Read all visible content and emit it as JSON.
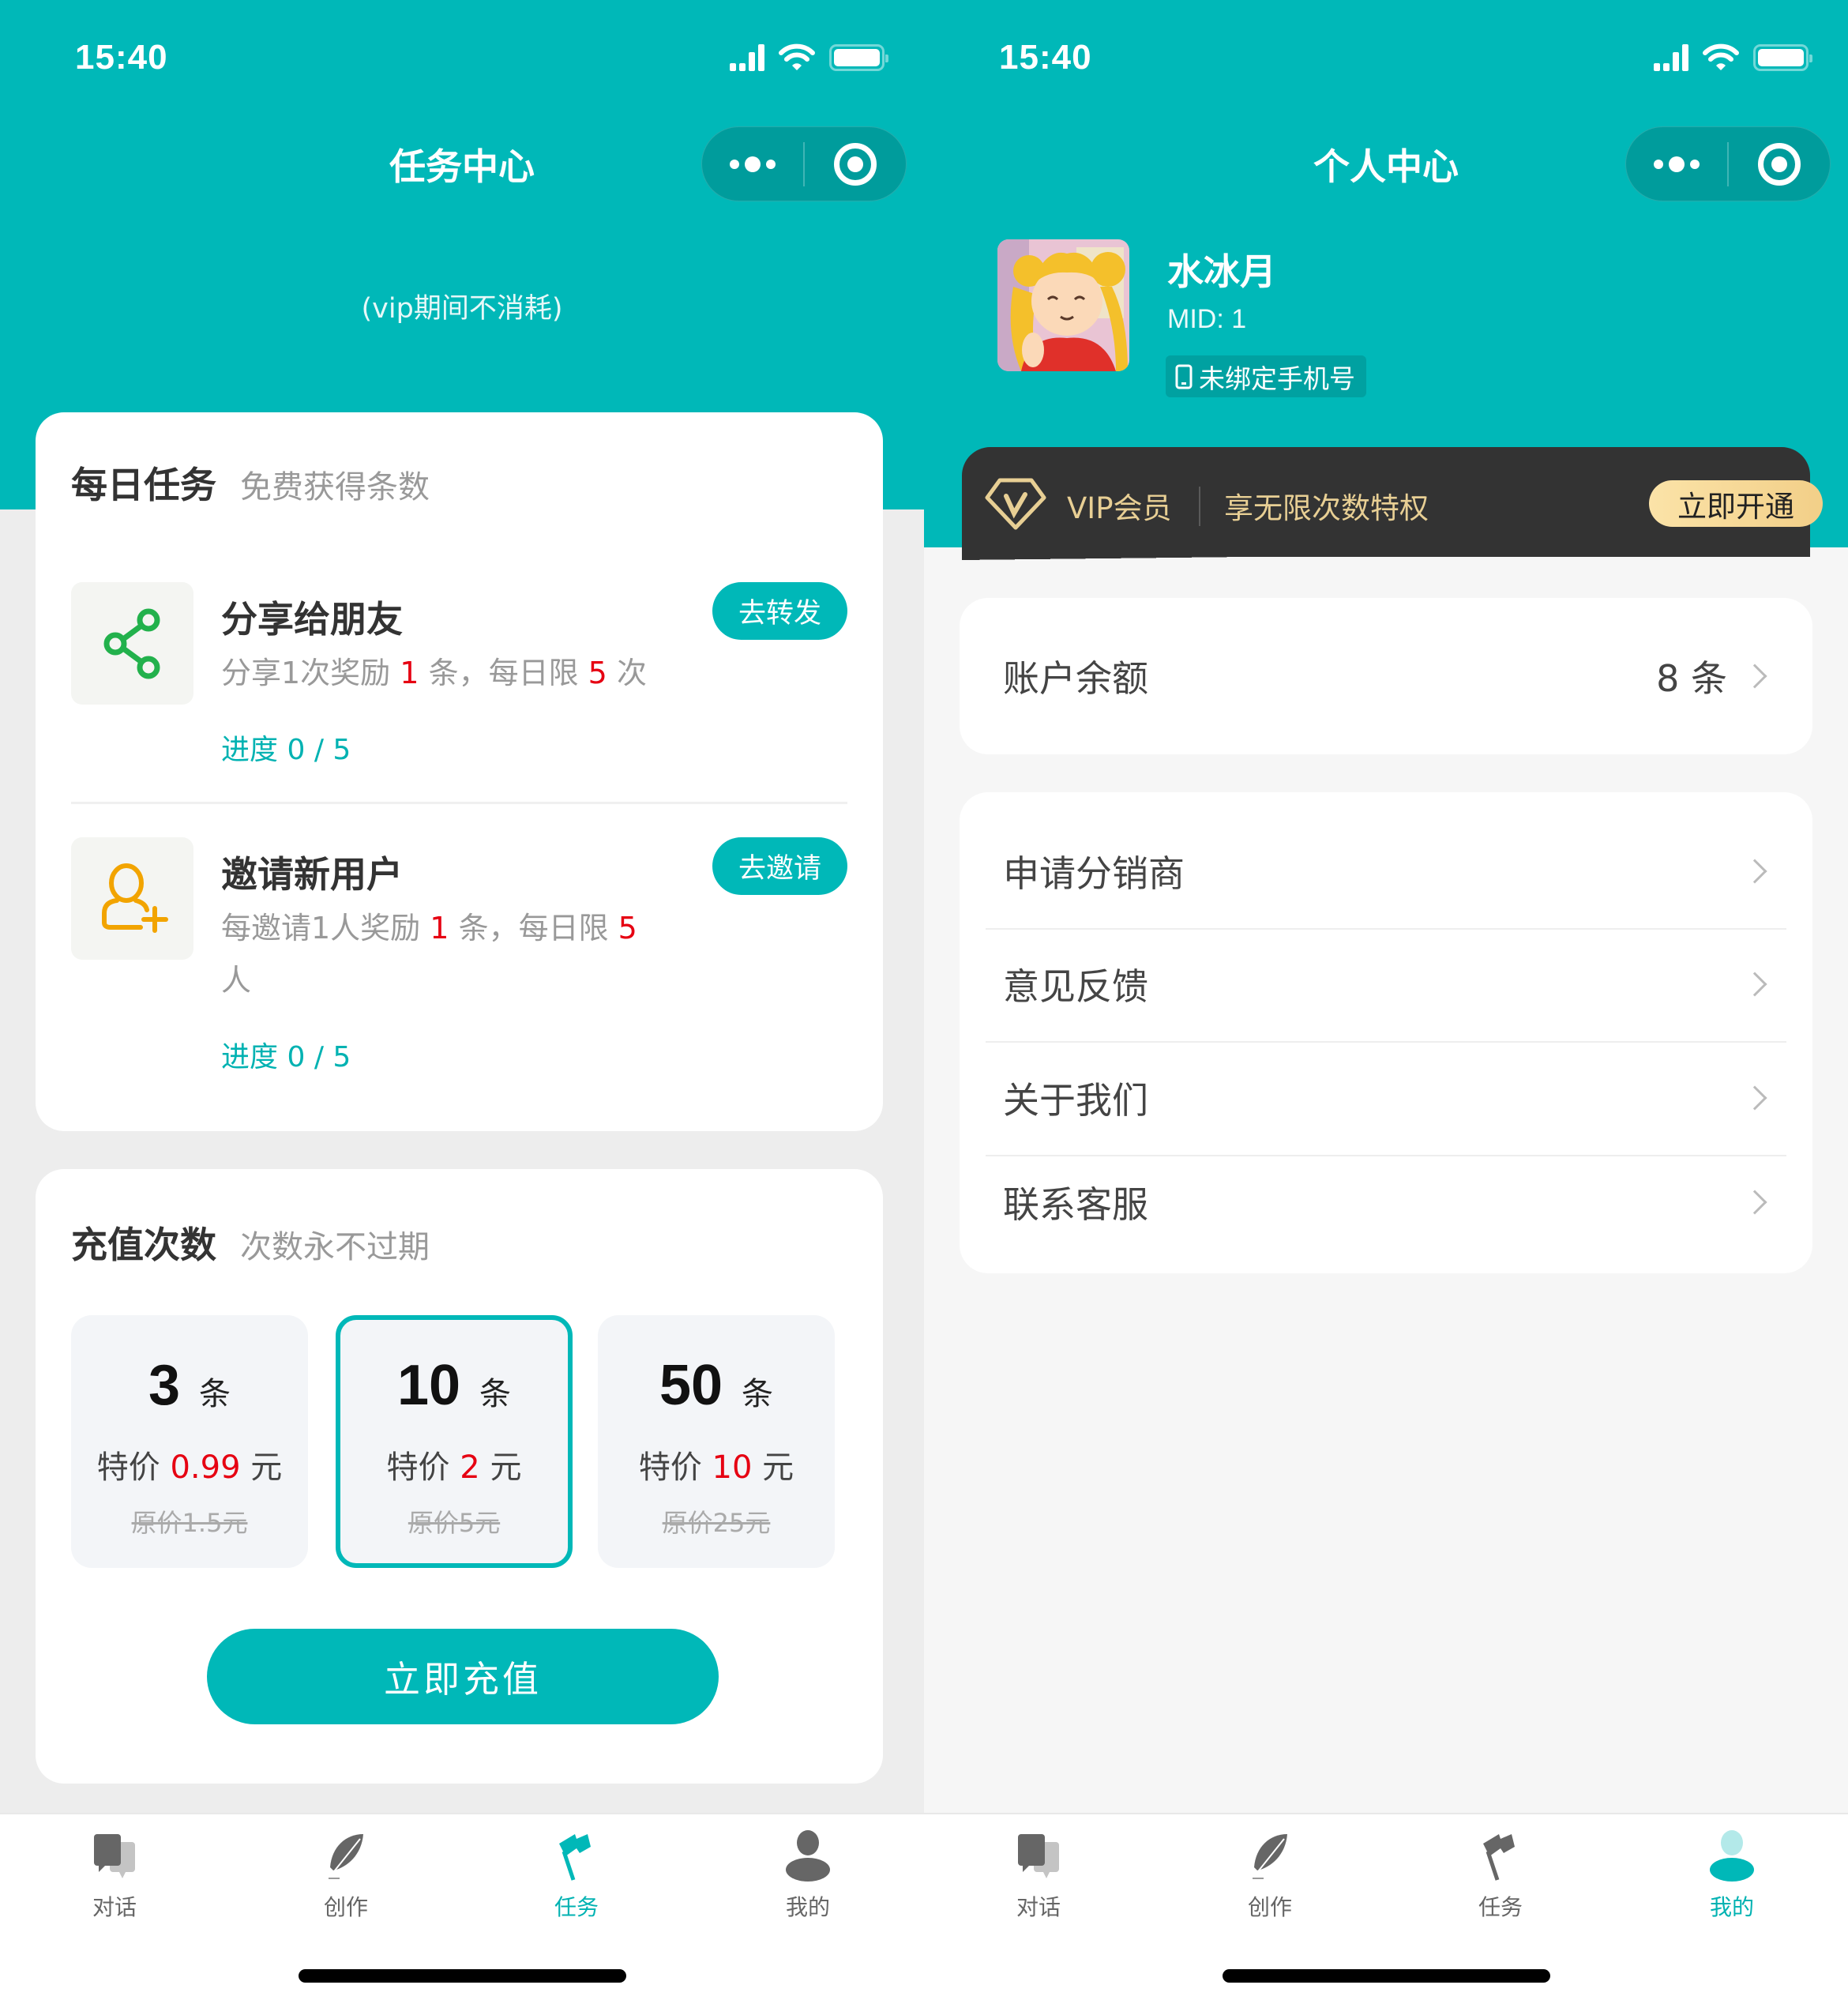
{
  "status_bar": {
    "time": "15:40"
  },
  "task_page": {
    "title": "任务中心",
    "subtitle": "(vip期间不消耗)",
    "daily": {
      "title": "每日任务",
      "subtitle": "免费获得条数",
      "tasks": [
        {
          "icon": "share-icon",
          "icon_color": "#22b14c",
          "title": "分享给朋友",
          "desc_prefix": "分享1次奖励",
          "reward": "1",
          "desc_mid": "条，每日限",
          "limit": "5",
          "desc_suffix": "次",
          "progress_label": "进度",
          "progress": "0 / 5",
          "button": "去转发"
        },
        {
          "icon": "add-user-icon",
          "icon_color": "#f2a400",
          "title": "邀请新用户",
          "desc_prefix": "每邀请1人奖励",
          "reward": "1",
          "desc_mid": "条，每日限",
          "limit": "5",
          "desc_suffix": "人",
          "progress_label": "进度",
          "progress": "0 / 5",
          "button": "去邀请"
        }
      ]
    },
    "recharge": {
      "title": "充值次数",
      "subtitle": "次数永不过期",
      "packages": [
        {
          "amount": "3",
          "unit": "条",
          "price_label": "特价",
          "price": "0.99",
          "currency": "元",
          "original": "原价1.5元",
          "selected": false
        },
        {
          "amount": "10",
          "unit": "条",
          "price_label": "特价",
          "price": "2",
          "currency": "元",
          "original": "原价5元",
          "selected": true
        },
        {
          "amount": "50",
          "unit": "条",
          "price_label": "特价",
          "price": "10",
          "currency": "元",
          "original": "原价25元",
          "selected": false
        }
      ],
      "button": "立即充值"
    }
  },
  "profile_page": {
    "title": "个人中心",
    "user": {
      "name": "水冰月",
      "mid": "MID: 1",
      "phone_badge": "未绑定手机号"
    },
    "vip": {
      "label": "VIP会员",
      "desc": "享无限次数特权",
      "button": "立即开通"
    },
    "balance": {
      "label": "账户余额",
      "value": "8 条"
    },
    "menu": [
      "申请分销商",
      "意见反馈",
      "关于我们",
      "联系客服"
    ]
  },
  "tabbar": {
    "items": [
      {
        "label": "对话",
        "icon": "chat-icon"
      },
      {
        "label": "创作",
        "icon": "feather-icon"
      },
      {
        "label": "任务",
        "icon": "flag-icon"
      },
      {
        "label": "我的",
        "icon": "user-icon"
      }
    ],
    "left_active": 2,
    "right_active": 3
  },
  "colors": {
    "accent": "#00b8b8",
    "price_red": "#e60012",
    "vip_gold": "#e8cf94",
    "vip_dark": "#333333"
  }
}
